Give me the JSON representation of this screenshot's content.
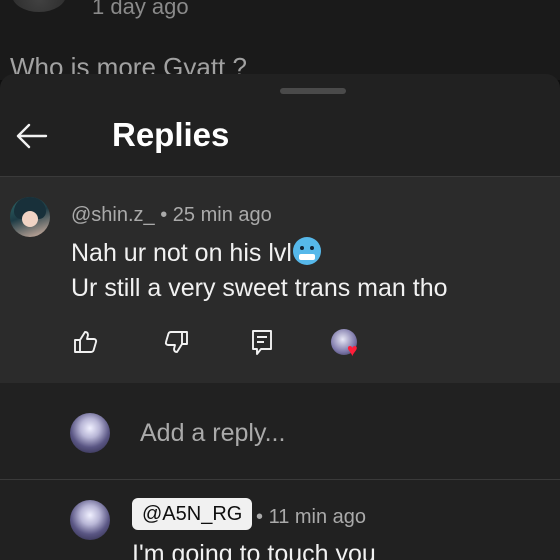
{
  "background_comment": {
    "time": "1 day ago",
    "text": "Who is more Gyatt ?"
  },
  "header": {
    "back_icon": "arrow-left-icon",
    "title": "Replies"
  },
  "comment": {
    "author": "@shin.z_",
    "time": "25 min ago",
    "line1": "Nah ur not on his lvl",
    "emoji": "cold-face-emoji",
    "line2": "Ur still a very sweet trans man tho",
    "actions": {
      "like_icon": "thumbs-up-icon",
      "dislike_icon": "thumbs-down-icon",
      "reply_icon": "reply-comment-icon",
      "creator_heart_icon": "creator-heart-icon"
    }
  },
  "add_reply": {
    "placeholder": "Add a reply..."
  },
  "reply": {
    "author": "@A5N_RG",
    "time": "11 min ago",
    "text": "I'm going to touch you"
  },
  "colors": {
    "background": "#0f0f0f",
    "sheet": "#212121",
    "highlighted_comment": "#2b2b2b",
    "secondary_text": "#aaaaaa",
    "heart": "#ff1e3a"
  }
}
